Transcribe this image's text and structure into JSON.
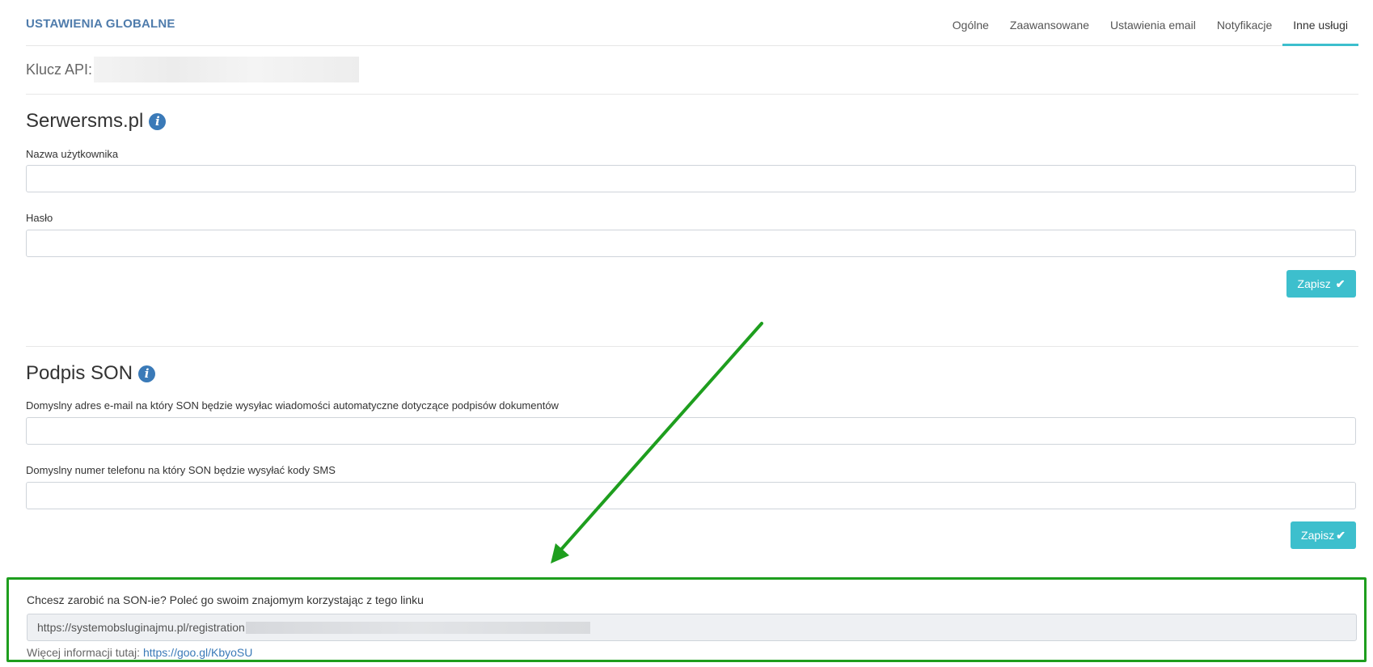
{
  "header": {
    "title": "USTAWIENIA GLOBALNE",
    "tabs": [
      "Ogólne",
      "Zaawansowane",
      "Ustawienia email",
      "Notyfikacje",
      "Inne usługi"
    ],
    "active_tab": "Inne usługi"
  },
  "api": {
    "label": "Klucz API:"
  },
  "serwersms": {
    "title": "Serwersms.pl",
    "username_label": "Nazwa użytkownika",
    "password_label": "Hasło",
    "save_label": "Zapisz"
  },
  "son": {
    "title": "Podpis SON",
    "email_label": "Domyslny adres e-mail na który SON będzie wysyłac wiadomości automatyczne dotyczące podpisów dokumentów",
    "phone_label": "Domyslny numer telefonu na który SON będzie wysyłać kody SMS",
    "save_label": "Zapisz"
  },
  "referral": {
    "text": "Chcesz zarobić na SON-ie? Poleć go swoim znajomym korzystając z tego linku",
    "link_value": "https://systemobsluginajmu.pl/registration",
    "more_info_label": "Więcej informacji tutaj:",
    "more_info_link": "https://goo.gl/KbyoSU"
  },
  "colors": {
    "accent": "#3dbfcd",
    "title_blue": "#4f7cac",
    "info_icon": "#3a7ab8",
    "highlight_green": "#1e9e1e"
  },
  "icons": {
    "info": "info-circle-icon",
    "check": "check-icon"
  }
}
